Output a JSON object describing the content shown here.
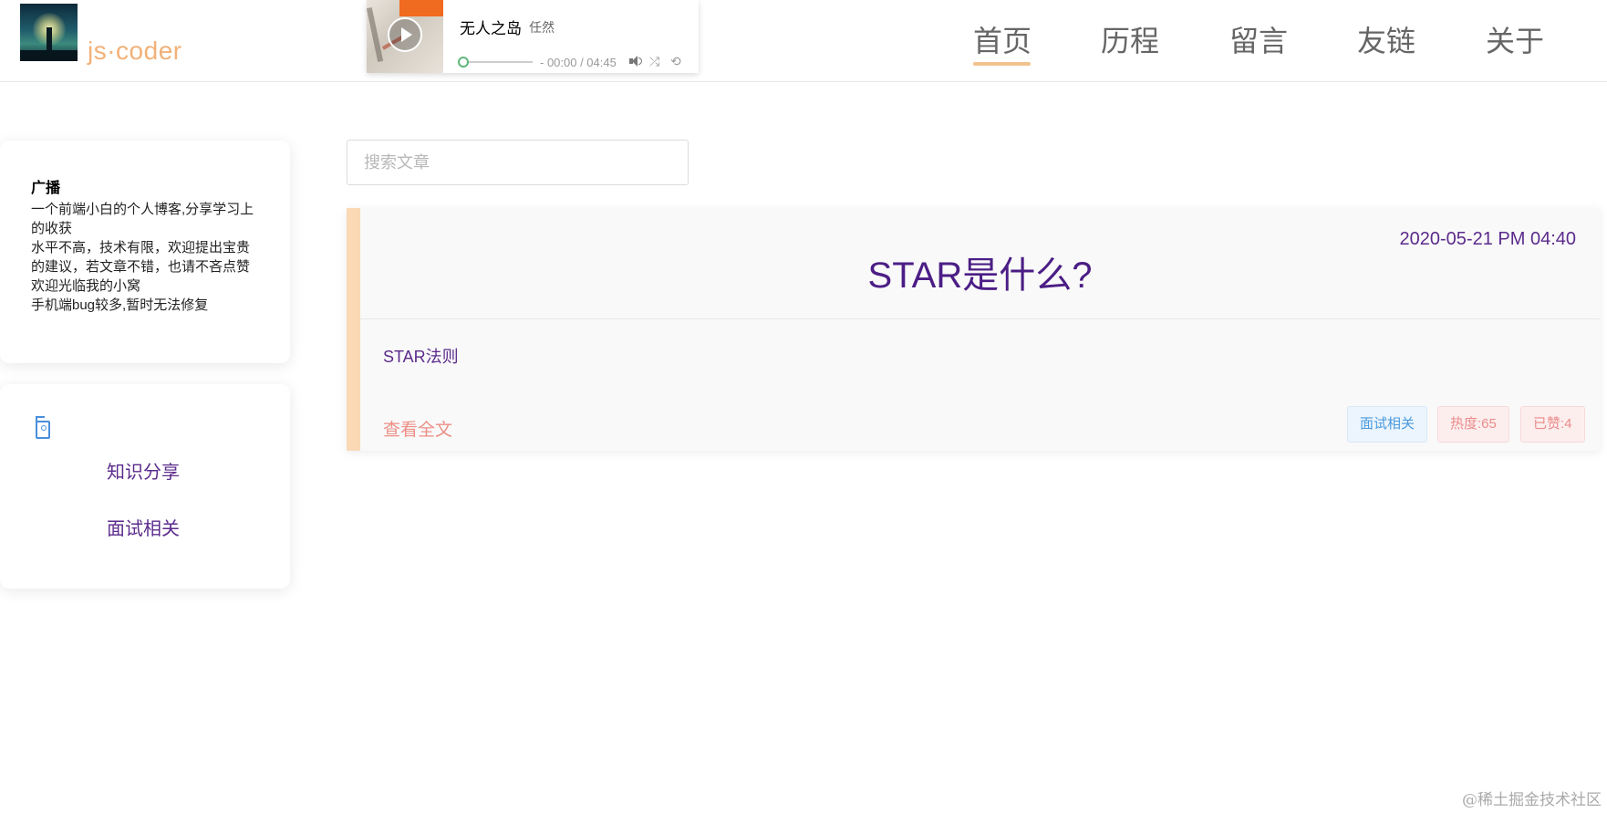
{
  "brand": {
    "name": "js·coder",
    "logo_icon": "lighthouse-logo"
  },
  "player": {
    "song_title": "无人之岛",
    "artist": "任然",
    "time": "- 00:00 / 04:45",
    "progress": 0,
    "icons": [
      "play-icon",
      "volume-icon",
      "shuffle-icon",
      "repeat-icon"
    ]
  },
  "nav": {
    "items": [
      {
        "label": "首页",
        "active": true
      },
      {
        "label": "历程"
      },
      {
        "label": "留言"
      },
      {
        "label": "友链"
      },
      {
        "label": "关于"
      }
    ]
  },
  "sidebar": {
    "broadcast": {
      "title": "广播",
      "lines": [
        "一个前端小白的个人博客,分享学习上的收获",
        "水平不高，技术有限，欢迎提出宝贵的建议，若文章不错，也请不吝点赞",
        "欢迎光临我的小窝",
        "手机端bug较多,暂时无法修复"
      ]
    },
    "categories": {
      "icon": "tag-icon",
      "items": [
        "知识分享",
        "面试相关"
      ]
    }
  },
  "search": {
    "placeholder": "搜索文章",
    "value": ""
  },
  "posts": [
    {
      "date": "2020-05-21 PM 04:40",
      "title": "STAR是什么?",
      "summary": "STAR法则",
      "read_more": "查看全文",
      "category": "面试相关",
      "heat": "热度:65",
      "likes": "已赞:4"
    }
  ],
  "watermark": "@稀土掘金技术社区",
  "colors": {
    "accent": "#f2b179",
    "title_purple": "#4b1d85",
    "link_purple": "#5b2b8c",
    "post_border": "#fbd8b6",
    "read_more": "#ec8f86"
  }
}
